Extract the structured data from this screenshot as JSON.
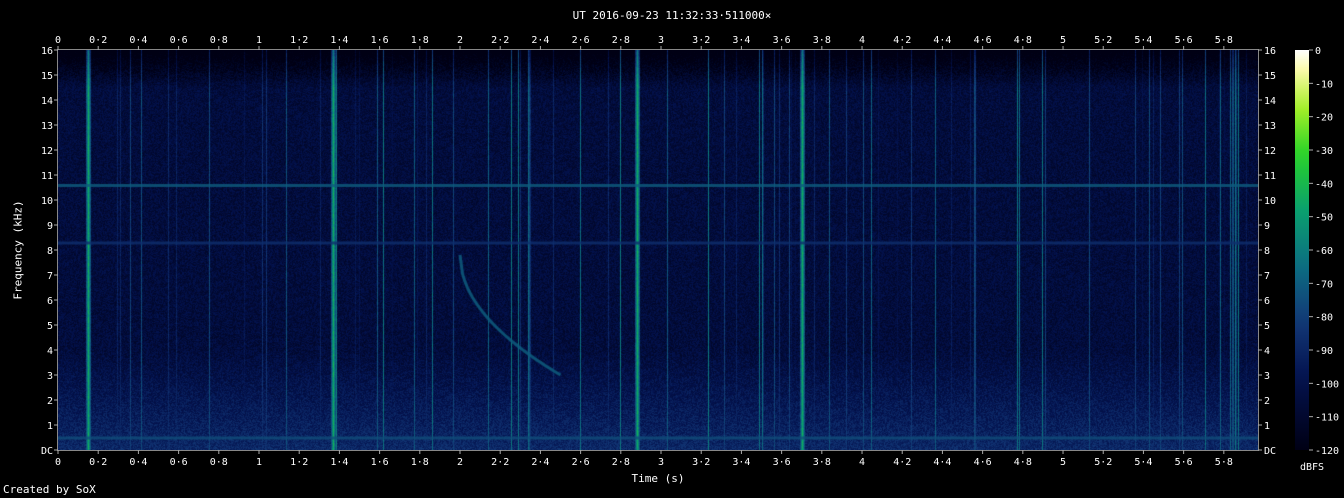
{
  "chart_data": {
    "type": "heatmap",
    "title": "UT 2016-09-23 11:32:33·511000×",
    "xlabel": "Time (s)",
    "ylabel": "Frequency (kHz)",
    "xlim": [
      0,
      5.97
    ],
    "ylim": [
      0,
      16
    ],
    "x_ticks": [
      "0",
      "0·2",
      "0·4",
      "0·6",
      "0·8",
      "1",
      "1·2",
      "1·4",
      "1·6",
      "1·8",
      "2",
      "2·2",
      "2·4",
      "2·6",
      "2·8",
      "3",
      "3·2",
      "3·4",
      "3·6",
      "3·8",
      "4",
      "4·2",
      "4·4",
      "4·6",
      "4·8",
      "5",
      "5·2",
      "5·4",
      "5·6",
      "5·8"
    ],
    "y_ticks": [
      "DC",
      "1",
      "2",
      "3",
      "4",
      "5",
      "6",
      "7",
      "8",
      "9",
      "10",
      "11",
      "12",
      "13",
      "14",
      "15",
      "16"
    ],
    "colorbar_label": "dBFS",
    "colorbar_ticks": [
      "0",
      "-10",
      "-20",
      "-30",
      "-40",
      "-50",
      "-60",
      "-70",
      "-80",
      "-90",
      "-100",
      "-110",
      "-120"
    ],
    "colorbar_range": [
      -120,
      0
    ],
    "background_level_dbfs": -105,
    "features": [
      {
        "kind": "tone",
        "freq_khz": 10.6,
        "level_dbfs": -70
      },
      {
        "kind": "tone",
        "freq_khz": 8.3,
        "level_dbfs": -85
      },
      {
        "kind": "tone",
        "freq_khz": 0.5,
        "level_dbfs": -75
      },
      {
        "kind": "sweep",
        "t_start": 2.0,
        "t_end": 2.5,
        "f_start_khz": 7.8,
        "f_end_khz": 3.0,
        "level_dbfs": -70
      },
      {
        "kind": "sferics",
        "strong_times_s": [
          0.15,
          1.37,
          2.88,
          3.7
        ],
        "level_dbfs": -45
      }
    ]
  },
  "footer": {
    "credit": "Created by SoX"
  }
}
